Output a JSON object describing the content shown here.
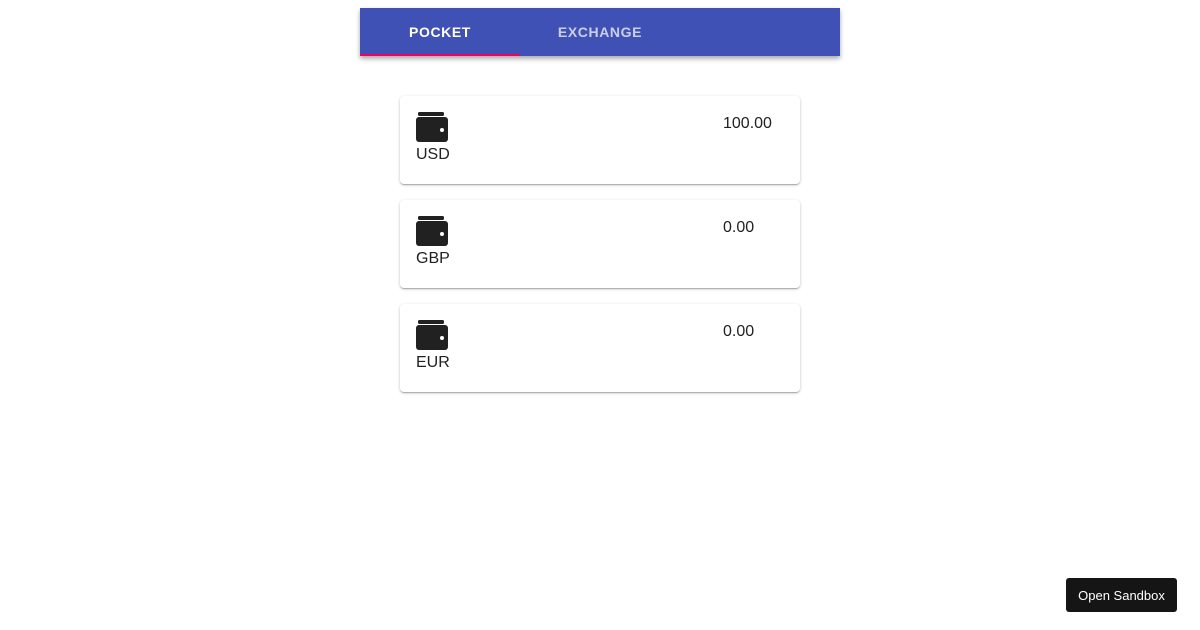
{
  "tabs": {
    "pocket_label": "POCKET",
    "exchange_label": "EXCHANGE",
    "active": "pocket",
    "bar_color": "#3f51b5",
    "indicator_color": "#f50057"
  },
  "pockets": [
    {
      "currency": "USD",
      "amount": "100.00",
      "icon": "wallet-icon"
    },
    {
      "currency": "GBP",
      "amount": "0.00",
      "icon": "wallet-icon"
    },
    {
      "currency": "EUR",
      "amount": "0.00",
      "icon": "wallet-icon"
    }
  ],
  "sandbox": {
    "label": "Open Sandbox"
  }
}
